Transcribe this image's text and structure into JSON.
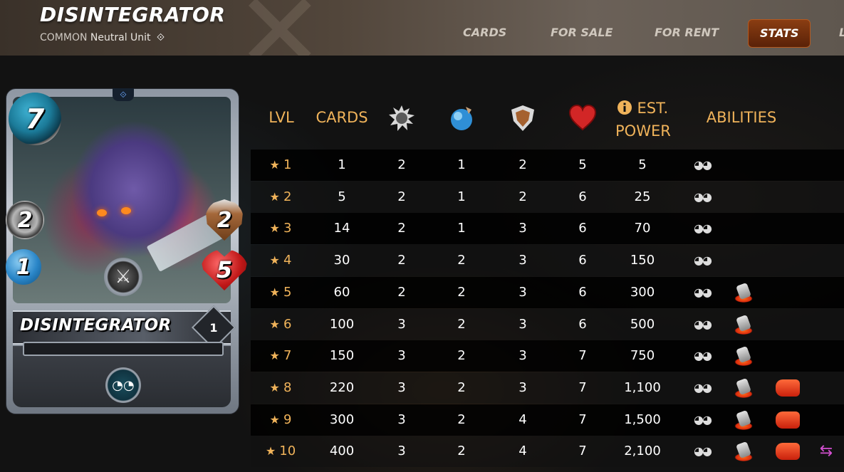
{
  "header": {
    "title": "DISINTEGRATOR",
    "rarity": "COMMON",
    "type_text": "Neutral Unit",
    "nav": [
      "CARDS",
      "FOR SALE",
      "FOR RENT",
      "STATS",
      "L"
    ],
    "active_nav": "STATS"
  },
  "card": {
    "name": "DISINTEGRATOR",
    "mana": "7",
    "attack": "2",
    "speed": "1",
    "armor": "2",
    "health": "5",
    "level": "1",
    "ability_icon": "eyes-icon"
  },
  "table": {
    "headers": {
      "lvl": "LVL",
      "cards": "CARDS",
      "attack_icon": "melee-attack-icon",
      "speed_icon": "speed-icon",
      "armor_icon": "armor-icon",
      "health_icon": "health-icon",
      "info_icon": "info-icon",
      "power_line1": "EST.",
      "power_line2": "POWER",
      "abilities": "ABILITIES"
    },
    "rows": [
      {
        "lvl": "1",
        "cards": "1",
        "attack": "2",
        "speed": "1",
        "armor": "2",
        "health": "5",
        "power": "5",
        "abilities": [
          "blind"
        ]
      },
      {
        "lvl": "2",
        "cards": "5",
        "attack": "2",
        "speed": "1",
        "armor": "2",
        "health": "6",
        "power": "25",
        "abilities": [
          "blind"
        ]
      },
      {
        "lvl": "3",
        "cards": "14",
        "attack": "2",
        "speed": "1",
        "armor": "3",
        "health": "6",
        "power": "70",
        "abilities": [
          "blind"
        ]
      },
      {
        "lvl": "4",
        "cards": "30",
        "attack": "2",
        "speed": "2",
        "armor": "3",
        "health": "6",
        "power": "150",
        "abilities": [
          "blind"
        ]
      },
      {
        "lvl": "5",
        "cards": "60",
        "attack": "2",
        "speed": "2",
        "armor": "3",
        "health": "6",
        "power": "300",
        "abilities": [
          "blind",
          "shatter"
        ]
      },
      {
        "lvl": "6",
        "cards": "100",
        "attack": "3",
        "speed": "2",
        "armor": "3",
        "health": "6",
        "power": "500",
        "abilities": [
          "blind",
          "shatter"
        ]
      },
      {
        "lvl": "7",
        "cards": "150",
        "attack": "3",
        "speed": "2",
        "armor": "3",
        "health": "7",
        "power": "750",
        "abilities": [
          "blind",
          "shatter"
        ]
      },
      {
        "lvl": "8",
        "cards": "220",
        "attack": "3",
        "speed": "2",
        "armor": "3",
        "health": "7",
        "power": "1,100",
        "abilities": [
          "blind",
          "shatter",
          "knock-out"
        ]
      },
      {
        "lvl": "9",
        "cards": "300",
        "attack": "3",
        "speed": "2",
        "armor": "4",
        "health": "7",
        "power": "1,500",
        "abilities": [
          "blind",
          "shatter",
          "knock-out"
        ]
      },
      {
        "lvl": "10",
        "cards": "400",
        "attack": "3",
        "speed": "2",
        "armor": "4",
        "health": "7",
        "power": "2,100",
        "abilities": [
          "blind",
          "shatter",
          "knock-out",
          "return-fire"
        ]
      }
    ]
  },
  "colors": {
    "header_label": "#f0b35a",
    "active_nav": "#7a3210"
  }
}
